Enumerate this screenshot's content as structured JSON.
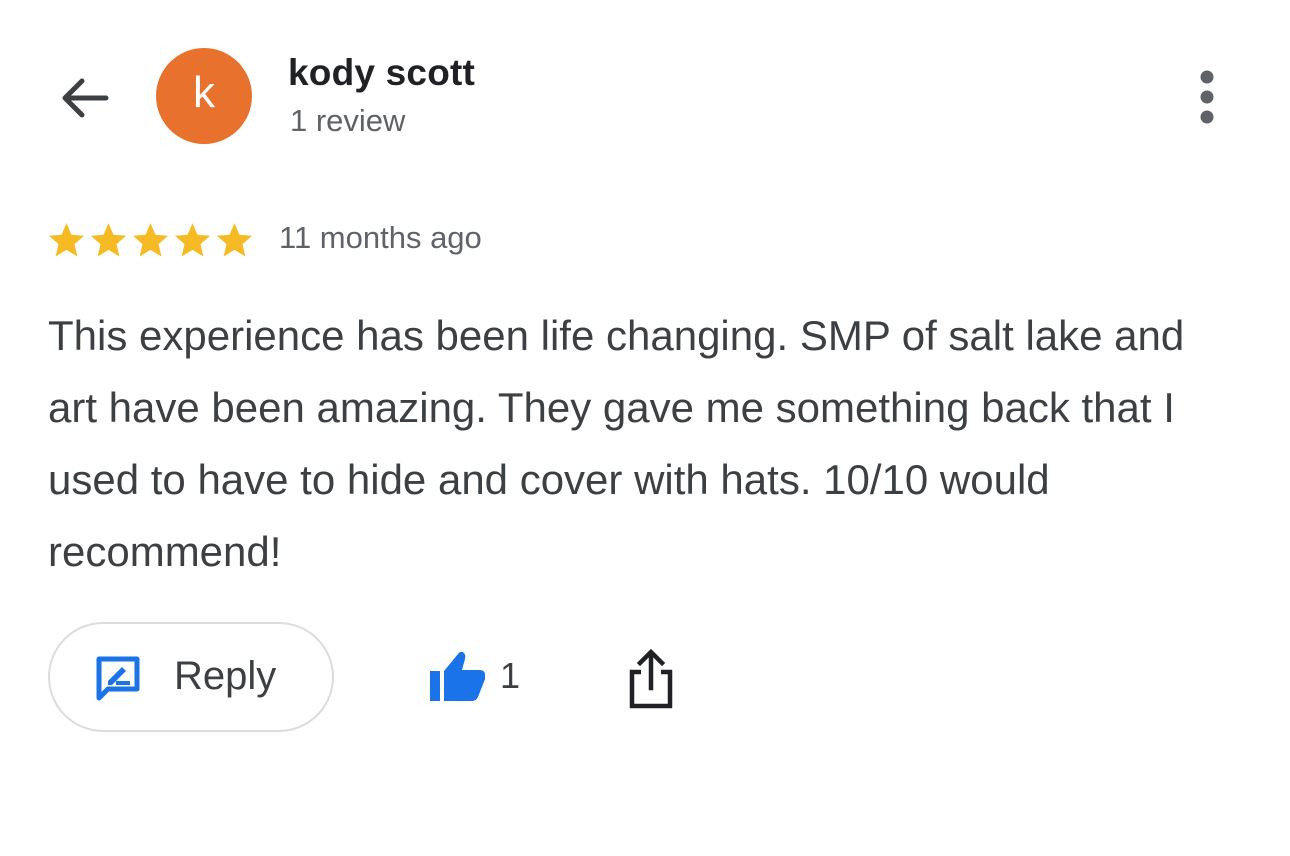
{
  "reviewer": {
    "avatar_initial": "k",
    "avatar_color": "#e8712d",
    "name": "kody scott",
    "review_count": "1 review"
  },
  "review": {
    "rating": 5,
    "rating_max": 5,
    "star_color": "#f6bb24",
    "time_ago": "11 months ago",
    "text": "This experience has been life changing. SMP of salt lake and art have been amazing. They gave me something back that I used to have to hide and cover with hats. 10/10 would recommend!"
  },
  "actions": {
    "reply_label": "Reply",
    "like_count": "1",
    "accent_color": "#1a73e8"
  },
  "icons": {
    "back": "arrow-left-icon",
    "more": "more-vert-icon",
    "reply": "rate-review-icon",
    "like": "thumb-up-icon",
    "share": "share-icon"
  }
}
